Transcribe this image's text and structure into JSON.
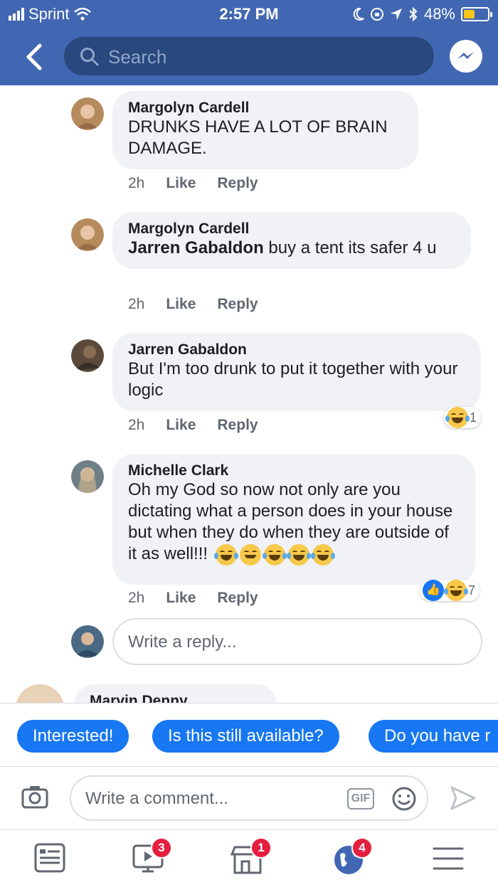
{
  "status_bar": {
    "carrier": "Sprint",
    "time": "2:57 PM",
    "battery": "48%",
    "battery_level": 0.48
  },
  "nav": {
    "search_placeholder": "Search",
    "icons": [
      "back-arrow-icon",
      "search-icon",
      "messenger-icon"
    ]
  },
  "comments": [
    {
      "author": "Margolyn Cardell",
      "mention": "",
      "text": "DRUNKS HAVE A LOT OF BRAIN DAMAGE.",
      "time": "2h",
      "like_label": "Like",
      "reply_label": "Reply"
    },
    {
      "author": "Margolyn Cardell",
      "mention": "Jarren Gabaldon",
      "text": " buy a tent its safer 4 u",
      "time": "2h",
      "like_label": "Like",
      "reply_label": "Reply"
    },
    {
      "author": "Jarren Gabaldon",
      "mention": "",
      "text": "But I'm too drunk to put it together with your logic",
      "time": "2h",
      "like_label": "Like",
      "reply_label": "Reply",
      "reactions": {
        "icons": [
          "laughing-emoji-icon"
        ],
        "count": "1"
      }
    },
    {
      "author": "Michelle Clark",
      "mention": "",
      "text": "Oh my God so now not only are you dictating what a person does in your house but when they do when they are outside of it as well!!!",
      "time": "2h",
      "like_label": "Like",
      "reply_label": "Reply",
      "reactions": {
        "icons": [
          "like-icon",
          "laughing-emoji-icon"
        ],
        "count": "7"
      }
    }
  ],
  "reply_box": {
    "placeholder": "Write a reply..."
  },
  "next_comment": {
    "author": "Marvin Denny"
  },
  "quick_replies": [
    "Interested!",
    "Is this still available?",
    "Do you have r"
  ],
  "composer": {
    "placeholder": "Write a comment...",
    "gif_label": "GIF",
    "icons": [
      "camera-icon",
      "emoji-icon",
      "send-icon"
    ]
  },
  "tab_bar": {
    "tabs": [
      {
        "name": "news-feed-icon",
        "badge": ""
      },
      {
        "name": "watch-icon",
        "badge": "3"
      },
      {
        "name": "marketplace-icon",
        "badge": "1"
      },
      {
        "name": "notifications-globe-icon",
        "badge": "4"
      },
      {
        "name": "menu-icon",
        "badge": ""
      }
    ]
  },
  "colors": {
    "header_blue": "#4267b2",
    "search_bg": "#29487d",
    "chip_blue": "#1877f2",
    "bubble_gray": "#f0f2f5",
    "badge_red": "#e41e3f"
  }
}
